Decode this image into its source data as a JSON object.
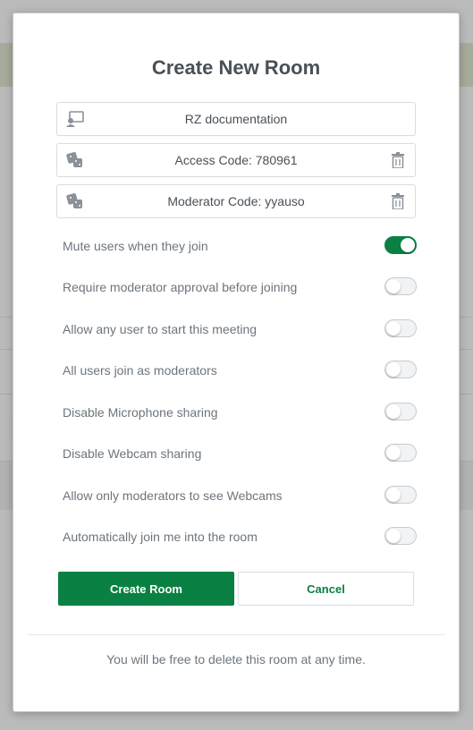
{
  "modal": {
    "title": "Create New Room",
    "room_name": {
      "value": "RZ documentation",
      "icon": "room-name-icon"
    },
    "access_code": {
      "value": "Access Code: 780961",
      "icon": "dice-icon"
    },
    "moderator_code": {
      "value": "Moderator Code: yyauso",
      "icon": "dice-icon"
    },
    "options": [
      {
        "label": "Mute users when they join",
        "enabled": true
      },
      {
        "label": "Require moderator approval before joining",
        "enabled": false
      },
      {
        "label": "Allow any user to start this meeting",
        "enabled": false
      },
      {
        "label": "All users join as moderators",
        "enabled": false
      },
      {
        "label": "Disable Microphone sharing",
        "enabled": false
      },
      {
        "label": "Disable Webcam sharing",
        "enabled": false
      },
      {
        "label": "Allow only moderators to see Webcams",
        "enabled": false
      },
      {
        "label": "Automatically join me into the room",
        "enabled": false
      }
    ],
    "create_button": "Create Room",
    "cancel_button": "Cancel",
    "footer": "You will be free to delete this room at any time."
  },
  "colors": {
    "primary": "#0a8043",
    "text": "#495057",
    "muted": "#6c757d"
  }
}
